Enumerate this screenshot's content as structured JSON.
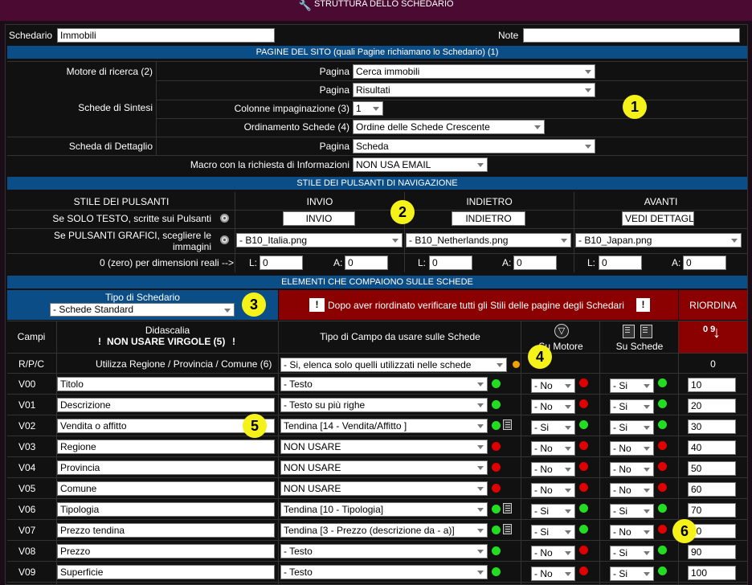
{
  "title": "STRUTTURA DELLO SCHEDARIO",
  "schedario": {
    "label": "Schedario",
    "value": "Immobili",
    "note_label": "Note",
    "note_value": ""
  },
  "pagine": {
    "header": "PAGINE DEL SITO (quali Pagine richiamano lo Schedario) (1)",
    "motore_label": "Motore di ricerca (2)",
    "pagina_label": "Pagina",
    "motore_value": "Cerca immobili",
    "sintesi_label": "Schede di Sintesi",
    "sintesi_pagina": "Risultati",
    "colonne_label": "Colonne impaginazione (3)",
    "colonne_value": "1",
    "ordinamento_label": "Ordinamento Schede (4)",
    "ordinamento_value": "Ordine delle Schede Crescente",
    "dettaglio_label": "Scheda di Dettaglio",
    "dettaglio_value": "Scheda",
    "macro_label": "Macro con la richiesta di Informazioni",
    "macro_value": "NON USA EMAIL"
  },
  "stile": {
    "header": "STILE DEI PULSANTI DI NAVIGAZIONE",
    "col_stile": "STILE DEI PULSANTI",
    "col_invio": "INVIO",
    "col_indietro": "INDIETRO",
    "col_avanti": "AVANTI",
    "testo_label": "Se SOLO TESTO, scritte sui Pulsanti",
    "invio_text": "INVIO",
    "indietro_text": "INDIETRO",
    "avanti_text": "VEDI DETTAGLI",
    "grafici_label1": "Se PULSANTI GRAFICI, scegliere le",
    "grafici_label2": "immagini",
    "img_invio": "- B10_Italia.png",
    "img_indietro": "- B10_Netherlands.png",
    "img_avanti": "- B10_Japan.png",
    "zero_label": "0 (zero) per dimensioni reali -->",
    "l_label": "L:",
    "a_label": "A:",
    "dim_val": "0"
  },
  "elementi": {
    "header": "ELEMENTI CHE COMPAIONO SULLE SCHEDE",
    "tipo_label": "Tipo di Schedario",
    "tipo_value": "- Schede Standard",
    "warning": "Dopo aver riordinato verificare tutti gli Stili delle pagine degli Schedari",
    "riordina": "RIORDINA",
    "col_campi": "Campi",
    "col_didascalia": "Didascalia",
    "col_virgole": "NON USARE VIRGOLE (5)",
    "col_tipo": "Tipo di Campo da usare sulle Schede",
    "col_motore": "Su Motore",
    "col_schede": "Su Schede",
    "sort_icon": "0 9",
    "rpc_code": "R/P/C",
    "rpc_label": "Utilizza Regione / Provincia / Comune (6)",
    "rpc_value": "- Si, elenca solo quelli utilizzati nelle schede",
    "rpc_order": "0"
  },
  "rows": [
    {
      "code": "V00",
      "name": "Titolo",
      "tipo": "- Testo",
      "motore": "- No",
      "schede": "- Si",
      "order": "10",
      "t": "g",
      "m": "rd",
      "s": "g",
      "doc": false
    },
    {
      "code": "V01",
      "name": "Descrizione",
      "tipo": "- Testo su più righe",
      "motore": "- No",
      "schede": "- Si",
      "order": "20",
      "t": "g",
      "m": "rd",
      "s": "g",
      "doc": false
    },
    {
      "code": "V02",
      "name": "Vendita o affitto",
      "tipo": "Tendina [14 - Vendita/Affitto ]",
      "motore": "- Si",
      "schede": "- Si",
      "order": "30",
      "t": "g",
      "m": "g",
      "s": "g",
      "doc": true
    },
    {
      "code": "V03",
      "name": "Regione",
      "tipo": "NON USARE",
      "motore": "- No",
      "schede": "- No",
      "order": "40",
      "t": "rd",
      "m": "rd",
      "s": "rd",
      "doc": false
    },
    {
      "code": "V04",
      "name": "Provincia",
      "tipo": "NON USARE",
      "motore": "- No",
      "schede": "- No",
      "order": "50",
      "t": "rd",
      "m": "rd",
      "s": "rd",
      "doc": false
    },
    {
      "code": "V05",
      "name": "Comune",
      "tipo": "NON USARE",
      "motore": "- No",
      "schede": "- No",
      "order": "60",
      "t": "rd",
      "m": "rd",
      "s": "rd",
      "doc": false
    },
    {
      "code": "V06",
      "name": "Tipologia",
      "tipo": "Tendina [10 - Tipologia]",
      "motore": "- Si",
      "schede": "- Si",
      "order": "70",
      "t": "g",
      "m": "g",
      "s": "g",
      "doc": true
    },
    {
      "code": "V07",
      "name": "Prezzo tendina",
      "tipo": "Tendina [3 - Prezzo (descrizione da - a)]",
      "motore": "- Si",
      "schede": "- No",
      "order": "80",
      "t": "g",
      "m": "g",
      "s": "rd",
      "doc": true
    },
    {
      "code": "V08",
      "name": "Prezzo",
      "tipo": "- Testo",
      "motore": "- No",
      "schede": "- Si",
      "order": "90",
      "t": "g",
      "m": "rd",
      "s": "g",
      "doc": false
    },
    {
      "code": "V09",
      "name": "Superficie",
      "tipo": "- Testo",
      "motore": "- No",
      "schede": "- Si",
      "order": "100",
      "t": "g",
      "m": "rd",
      "s": "g",
      "doc": false
    }
  ],
  "markers": [
    "1",
    "2",
    "3",
    "4",
    "5",
    "6"
  ],
  "colors": {
    "header_blue": "#0b4e87",
    "warning_red": "#8b0000",
    "title_bar": "#4a0a32",
    "badge": "#f5f21a"
  }
}
